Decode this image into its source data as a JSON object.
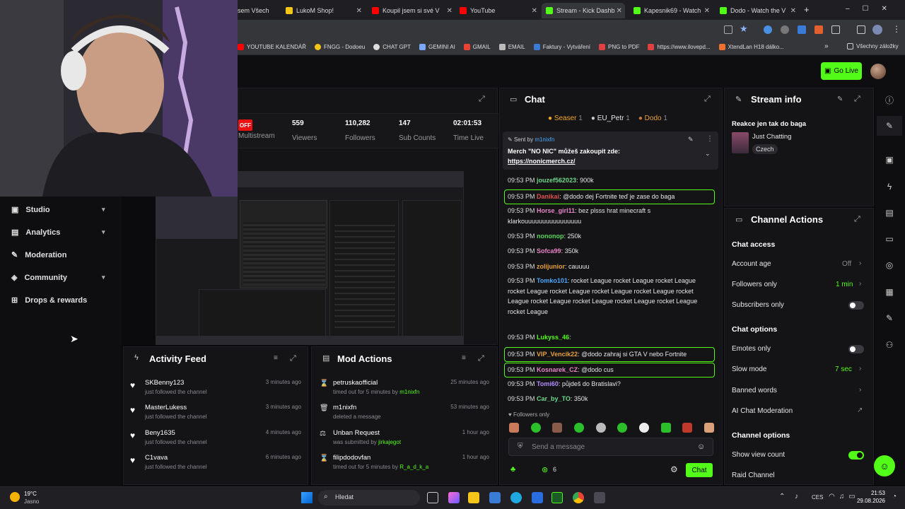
{
  "tabs": [
    {
      "label": "sem Všech"
    },
    {
      "label": "LukoM Shop!"
    },
    {
      "label": "Koupil jsem si své V"
    },
    {
      "label": "YouTube"
    },
    {
      "label": "Stream - Kick Dashb"
    },
    {
      "label": "Kapesnik69 - Watch"
    },
    {
      "label": "Dodo - Watch the V"
    }
  ],
  "bookmarks": [
    "YOUTUBE KALENDÁŘ",
    "FNGG - Dodoeu",
    "CHAT GPT",
    "GEMINI AI",
    "GMAIL",
    "EMAIL",
    "Faktury - Vytváření",
    "PNG to PDF",
    "https://www.ilovepd...",
    "XtendLan H18 dálko...",
    "Všechny záložky"
  ],
  "header": {
    "go_live": "Go Live"
  },
  "stream": {
    "status": "OFF",
    "stats": [
      {
        "value": "",
        "label": "Multistream"
      },
      {
        "value": "559",
        "label": "Viewers"
      },
      {
        "value": "110,282",
        "label": "Followers"
      },
      {
        "value": "147",
        "label": "Sub Counts"
      },
      {
        "value": "02:01:53",
        "label": "Time Live"
      }
    ]
  },
  "sidebar": {
    "items": [
      {
        "label": "Studio"
      },
      {
        "label": "Analytics"
      },
      {
        "label": "Moderation"
      },
      {
        "label": "Community"
      },
      {
        "label": "Drops & rewards"
      }
    ]
  },
  "chat": {
    "title": "Chat",
    "top_gifters": [
      {
        "name": "Seaser",
        "count": "1"
      },
      {
        "name": "EU_Petr",
        "count": "1"
      },
      {
        "name": "Dodo",
        "count": "1"
      }
    ],
    "pinned": {
      "sent_by": "Sent by",
      "user": "m1nixfn",
      "text": "Merch \"NO NIC\" můžeš zakoupit zde:",
      "link": "https://nonicmerch.cz/"
    },
    "messages": [
      {
        "time": "09:53 PM",
        "user": "jouzef562023",
        "text": ": 900k",
        "color": "#6fd88a"
      },
      {
        "time": "09:53 PM",
        "user": "Danikai",
        "text": ": @dodo dej Fortnite teď je zase do baga",
        "color": "#e05050",
        "hl": true
      },
      {
        "time": "09:53 PM",
        "user": "Horse_girl11",
        "text": ": bez plsss hrat minecraft s klarkouuuuuuuuuuuuuuuu",
        "color": "#e884c8"
      },
      {
        "time": "09:53 PM",
        "user": "nononop",
        "text": ": 250k",
        "color": "#5ad65a"
      },
      {
        "time": "09:53 PM",
        "user": "Sofca99",
        "text": ": 350k",
        "color": "#e884c8"
      },
      {
        "time": "09:53 PM",
        "user": "zolijunior",
        "text": ": cauuuu",
        "color": "#e8a040"
      },
      {
        "time": "09:53 PM",
        "user": "Tomko101",
        "text": ": rocket League rocket League rocket League rocket League rocket League rocket League rocket League rocket League rocket League rocket League rocket League rocket League rocket League",
        "color": "#4aa8ff"
      },
      {
        "time": "09:53 PM",
        "user": "Lukyss_46",
        "text": ":",
        "color": "#53fc18"
      },
      {
        "time": "09:53 PM",
        "user": "VIP_Vencik22",
        "text": ": @dodo zahraj si GTA V nebo Fortnite",
        "color": "#e8a040",
        "hl": true
      },
      {
        "time": "09:53 PM",
        "user": "Kosnarek_CZ",
        "text": ": @dodo cus",
        "color": "#e884c8",
        "hl": true
      },
      {
        "time": "09:53 PM",
        "user": "Tomi60",
        "text": ": půjdeš do Bratislavi?",
        "color": "#b58aff"
      },
      {
        "time": "09:53 PM",
        "user": "Car_by_TO",
        "text": ": 350k",
        "color": "#6fd88a"
      }
    ],
    "followers_only": "Followers only",
    "send_placeholder": "Send a message",
    "viewer_count": "6",
    "chat_button": "Chat"
  },
  "stream_info": {
    "title": "Stream info",
    "stream_title": "Reakce jen tak do baga",
    "category": "Just Chatting",
    "tag": "Czech"
  },
  "channel_actions": {
    "title": "Channel Actions",
    "chat_access": "Chat access",
    "account_age": {
      "label": "Account age",
      "value": "Off"
    },
    "followers_only": {
      "label": "Followers only",
      "value": "1 min"
    },
    "subscribers_only": {
      "label": "Subscribers only"
    },
    "chat_options": "Chat options",
    "emotes_only": {
      "label": "Emotes only"
    },
    "slow_mode": {
      "label": "Slow mode",
      "value": "7 sec"
    },
    "banned_words": {
      "label": "Banned words"
    },
    "ai_mod": {
      "label": "AI Chat Moderation"
    },
    "channel_options": "Channel options",
    "show_view_count": {
      "label": "Show view count"
    },
    "raid_channel": {
      "label": "Raid Channel"
    }
  },
  "activity": {
    "title": "Activity Feed",
    "items": [
      {
        "name": "SKBenny123",
        "sub": "just followed the channel",
        "time": "3 minutes ago"
      },
      {
        "name": "MasterLukess",
        "sub": "just followed the channel",
        "time": "3 minutes ago"
      },
      {
        "name": "Beny1635",
        "sub": "just followed the channel",
        "time": "4 minutes ago"
      },
      {
        "name": "C1vava",
        "sub": "just followed the channel",
        "time": "6 minutes ago"
      }
    ]
  },
  "mod_actions": {
    "title": "Mod Actions",
    "items": [
      {
        "name": "petruskaofficial",
        "sub": "timed out for 5 minutes by ",
        "by": "m1nixfn",
        "time": "25 minutes ago"
      },
      {
        "name": "m1nixfn",
        "sub": "deleted a message",
        "by": "",
        "time": "53 minutes ago"
      },
      {
        "name": "Unban Request",
        "sub": "was submitted by ",
        "by": "jirkajegot",
        "time": "1 hour ago"
      },
      {
        "name": "filipdodovfan",
        "sub": "timed out for 5 minutes by ",
        "by": "R_a_d_k_a",
        "time": "1 hour ago"
      }
    ]
  },
  "taskbar": {
    "weather_temp": "19°C",
    "weather_desc": "Jasno",
    "search": "Hledat",
    "lang": "CES",
    "time": "21:53",
    "date": "29.08.2026"
  },
  "colors": {
    "accent": "#53fc18",
    "panel": "#141416"
  }
}
